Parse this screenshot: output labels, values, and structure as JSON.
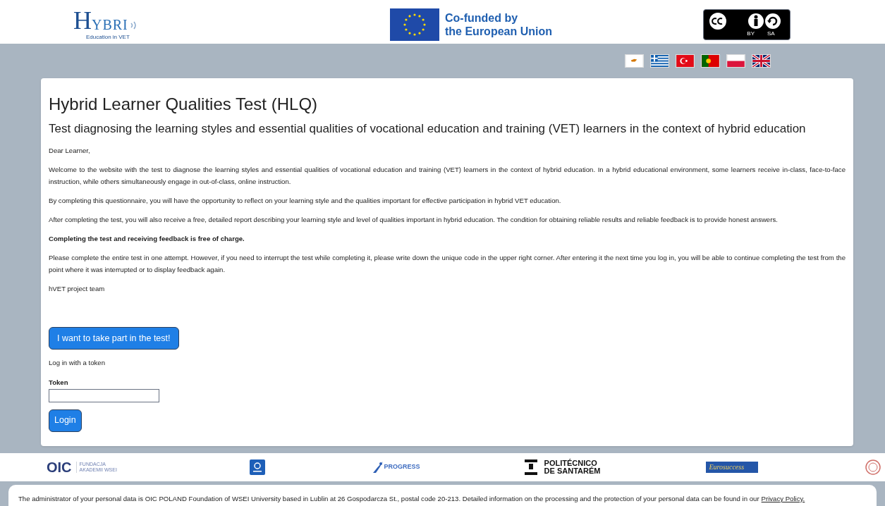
{
  "header": {
    "hybri_logo": {
      "letter": "H",
      "word": "YBRI",
      "tagline": "Education in VET"
    },
    "eu_logo": {
      "line_1": "Co-funded by",
      "line_2": "the European Union"
    },
    "license_badge": {
      "by": "BY",
      "sa": "SA"
    }
  },
  "main": {
    "title": "Hybrid Learner Qualities Test (HLQ)",
    "subtitle": "Test diagnosing the learning styles and essential qualities of vocational education and training (VET) learners in the context of hybrid education",
    "paragraphs": [
      {
        "kind": "plain",
        "text": "Dear Learner,"
      },
      {
        "kind": "plain",
        "text": "Welcome to the website with the test to diagnose the learning styles and essential qualities of vocational education and training (VET) learners in the context of hybrid education. In a hybrid educational environment, some learners receive in-class, face-to-face instruction, while others simultaneously engage in out-of-class, online instruction."
      },
      {
        "kind": "plain",
        "text": "By completing this questionnaire, you will have the opportunity to reflect on your learning style and the qualities important for effective participation in hybrid VET education."
      },
      {
        "kind": "plain",
        "text": "After completing the test, you will also receive a free, detailed report describing your learning style and level of qualities important in hybrid education. The condition for obtaining reliable results and reliable feedback is to provide honest answers."
      },
      {
        "kind": "bold",
        "text": "Completing the test and receiving feedback is free of charge."
      },
      {
        "kind": "plain",
        "text": "Please complete the entire test in one attempt. However, if you need to interrupt the test while completing it, please write down the unique code in the upper right corner. After entering it the next time you log in, you will be able to continue completing the test from the point where it was interrupted or to display feedback again."
      },
      {
        "kind": "plain",
        "text": "hVET project team"
      }
    ],
    "start_button": "I want to take part in the test!",
    "login_hint": "Log in with a token",
    "token_label": "Token",
    "login_button": "Login"
  },
  "partners": {
    "oic": "OIC",
    "oic_sub": "FUNDACJA AKADEMII WSEI",
    "progress": "PROGRESS",
    "ips_1": "POLITÉCNICO",
    "ips_2": "DE SANTARÉM",
    "eurosuccess": "Eurosuccess"
  },
  "privacy": {
    "text": "The administrator of your personal data is OIC POLAND Foundation of WSEI University based in Lublin at 26 Gospodarcza St., postal code 20-213. Detailed information on the processing and the protection of your personal data can be found in our",
    "link": "Privacy Policy."
  }
}
